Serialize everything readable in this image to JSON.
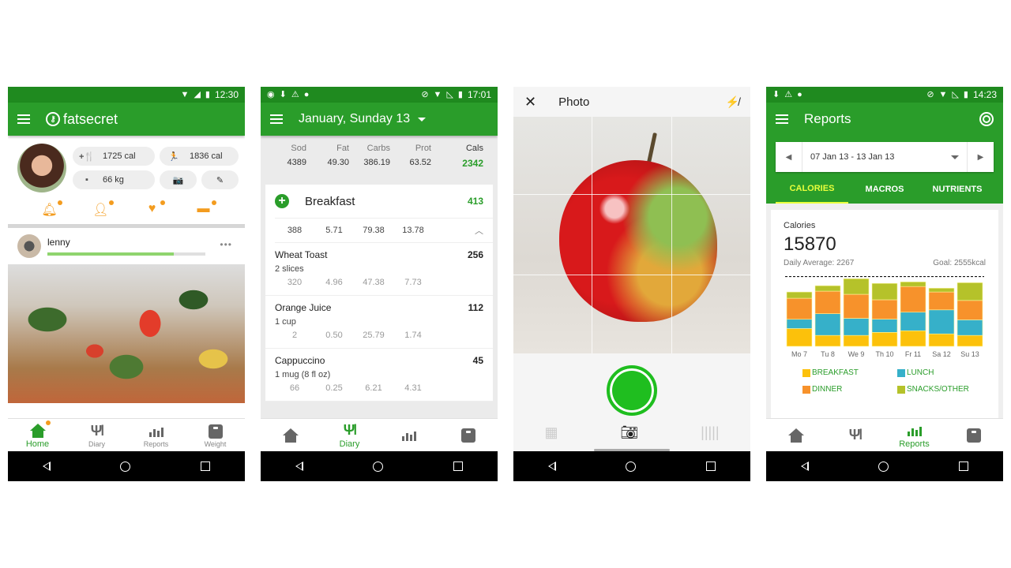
{
  "home_screen": {
    "status": {
      "time": "12:30",
      "icons": [
        "wifi-icon",
        "signal-icon",
        "battery-icon"
      ]
    },
    "app_title": "fatsecret",
    "stats": {
      "food_cal": "1725 cal",
      "exercise_cal": "1836 cal",
      "weight": "66 kg"
    },
    "notifications": [
      "bell-icon",
      "person-icon",
      "heart-icon",
      "chat-icon"
    ],
    "feed": {
      "user": "lenny",
      "progress_fraction": 0.8
    },
    "tabs": [
      {
        "label": "Home",
        "active": true
      },
      {
        "label": "Diary",
        "active": false
      },
      {
        "label": "Reports",
        "active": false
      },
      {
        "label": "Weight",
        "active": false
      }
    ]
  },
  "diary_screen": {
    "status": {
      "time": "17:01"
    },
    "title": "January, Sunday 13",
    "summary": {
      "headers": [
        "Sod",
        "Fat",
        "Carbs",
        "Prot",
        "Cals"
      ],
      "values": [
        "4389",
        "49.30",
        "386.19",
        "63.52",
        "2342"
      ]
    },
    "meal": {
      "name": "Breakfast",
      "calories": "413",
      "nutrients": [
        "388",
        "5.71",
        "79.38",
        "13.78"
      ]
    },
    "foods": [
      {
        "name": "Wheat Toast",
        "serving": "2 slices",
        "calories": "256",
        "nutrients": [
          "320",
          "4.96",
          "47.38",
          "7.73"
        ]
      },
      {
        "name": "Orange Juice",
        "serving": "1 cup",
        "calories": "112",
        "nutrients": [
          "2",
          "0.50",
          "25.79",
          "1.74"
        ]
      },
      {
        "name": "Cappuccino",
        "serving": "1 mug (8 fl oz)",
        "calories": "45",
        "nutrients": [
          "66",
          "0.25",
          "6.21",
          "4.31"
        ]
      }
    ],
    "tabs": [
      {
        "label": "",
        "active": false
      },
      {
        "label": "Diary",
        "active": true
      },
      {
        "label": "",
        "active": false
      },
      {
        "label": "",
        "active": false
      }
    ]
  },
  "photo_screen": {
    "title": "Photo",
    "modes": [
      "gallery-icon",
      "camera-icon",
      "barcode-icon"
    ],
    "active_mode": "camera-icon"
  },
  "reports_screen": {
    "status": {
      "time": "14:23"
    },
    "title": "Reports",
    "date_range": "07 Jan 13 - 13 Jan 13",
    "tabs": [
      {
        "label": "CALORIES",
        "active": true
      },
      {
        "label": "MACROS",
        "active": false
      },
      {
        "label": "NUTRIENTS",
        "active": false
      }
    ],
    "card": {
      "label": "Calories",
      "total": "15870",
      "daily_average": "Daily Average: 2267",
      "goal": "Goal: 2555kcal"
    },
    "legend": [
      {
        "label": "BREAKFAST",
        "color": "#fcc10b"
      },
      {
        "label": "LUNCH",
        "color": "#36b0c9"
      },
      {
        "label": "DINNER",
        "color": "#f7922b"
      },
      {
        "label": "SNACKS/OTHER",
        "color": "#b5c22a"
      }
    ],
    "bottom_tabs": [
      {
        "label": "",
        "active": false
      },
      {
        "label": "",
        "active": false
      },
      {
        "label": "Reports",
        "active": true
      },
      {
        "label": "",
        "active": false
      }
    ]
  },
  "colors": {
    "brand_green": "#2a9d2a",
    "status_green": "#1f8a1f",
    "accent_orange": "#f39c1f",
    "tab_highlight": "#e8ff3c"
  },
  "chart_data": {
    "type": "bar",
    "stacked": true,
    "title": "Calories",
    "categories": [
      "Mo 7",
      "Tu 8",
      "We 9",
      "Th 10",
      "Fr 11",
      "Sa 12",
      "Su 13"
    ],
    "series": [
      {
        "name": "BREAKFAST",
        "color": "#fcc10b",
        "values": [
          650,
          400,
          400,
          510,
          570,
          455,
          400
        ]
      },
      {
        "name": "LUNCH",
        "color": "#36b0c9",
        "values": [
          340,
          795,
          625,
          485,
          680,
          880,
          570
        ]
      },
      {
        "name": "DINNER",
        "color": "#f7922b",
        "values": [
          770,
          825,
          880,
          710,
          940,
          655,
          710
        ]
      },
      {
        "name": "SNACKS/OTHER",
        "color": "#b5c22a",
        "values": [
          230,
          200,
          570,
          600,
          170,
          140,
          650
        ]
      }
    ],
    "goal_line": 2555,
    "ylim": [
      0,
      2600
    ],
    "xlabel": "",
    "ylabel": "",
    "legend_position": "bottom",
    "grid": false
  }
}
